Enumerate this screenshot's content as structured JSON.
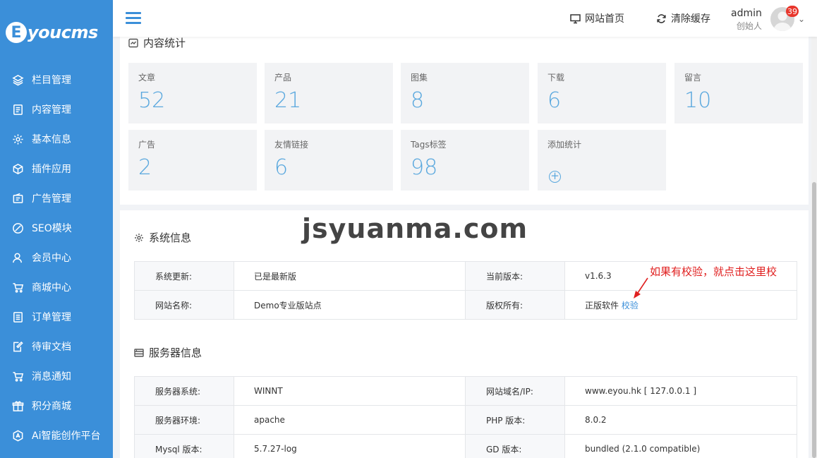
{
  "logo": {
    "mark": "E",
    "text": "youcms"
  },
  "sidebar": {
    "items": [
      {
        "label": "栏目管理",
        "icon": "layers-icon"
      },
      {
        "label": "内容管理",
        "icon": "document-icon"
      },
      {
        "label": "基本信息",
        "icon": "gear-icon"
      },
      {
        "label": "插件应用",
        "icon": "cube-icon"
      },
      {
        "label": "广告管理",
        "icon": "ad-icon"
      },
      {
        "label": "SEO模块",
        "icon": "seo-icon"
      },
      {
        "label": "会员中心",
        "icon": "user-icon"
      },
      {
        "label": "商城中心",
        "icon": "cart-icon"
      },
      {
        "label": "订单管理",
        "icon": "list-icon"
      },
      {
        "label": "待审文档",
        "icon": "edit-doc-icon"
      },
      {
        "label": "消息通知",
        "icon": "cart-icon"
      },
      {
        "label": "积分商城",
        "icon": "gift-icon"
      },
      {
        "label": "Ai智能创作平台",
        "icon": "ai-icon"
      }
    ]
  },
  "header": {
    "site_home": "网站首页",
    "clear_cache": "清除缓存",
    "user_name": "admin",
    "user_role": "创始人",
    "badge": "39"
  },
  "stats": {
    "title": "内容统计",
    "items": [
      {
        "label": "文章",
        "value": "52"
      },
      {
        "label": "产品",
        "value": "21"
      },
      {
        "label": "图集",
        "value": "8"
      },
      {
        "label": "下载",
        "value": "6"
      },
      {
        "label": "留言",
        "value": "10"
      },
      {
        "label": "广告",
        "value": "2"
      },
      {
        "label": "友情链接",
        "value": "6"
      },
      {
        "label": "Tags标签",
        "value": "98"
      },
      {
        "label": "添加统计",
        "value": "+"
      }
    ]
  },
  "system": {
    "title": "系统信息",
    "rows": [
      {
        "k1": "系统更新:",
        "v1": "已是最新版",
        "k2": "当前版本:",
        "v2": "v1.6.3"
      },
      {
        "k1": "网站名称:",
        "v1": "Demo专业版站点",
        "k2": "版权所有:",
        "v2": "正版软件",
        "v2_link": "校验"
      }
    ]
  },
  "server": {
    "title": "服务器信息",
    "rows": [
      {
        "k1": "服务器系统:",
        "v1": "WINNT",
        "k2": "网站域名/IP:",
        "v2": "www.eyou.hk [ 127.0.0.1 ]"
      },
      {
        "k1": "服务器环境:",
        "v1": "apache",
        "k2": "PHP 版本:",
        "v2": "8.0.2"
      },
      {
        "k1": "Mysql 版本:",
        "v1": "5.7.27-log",
        "k2": "GD 版本:",
        "v2": "bundled (2.1.0 compatible)"
      }
    ]
  },
  "overlay": {
    "watermark": "jsyuanma.com",
    "annotation": "如果有校验，就点击这里校"
  },
  "colors": {
    "sidebar": "#3b8fd9",
    "stat_value": "#5aa8de",
    "annotation": "#e02020"
  }
}
